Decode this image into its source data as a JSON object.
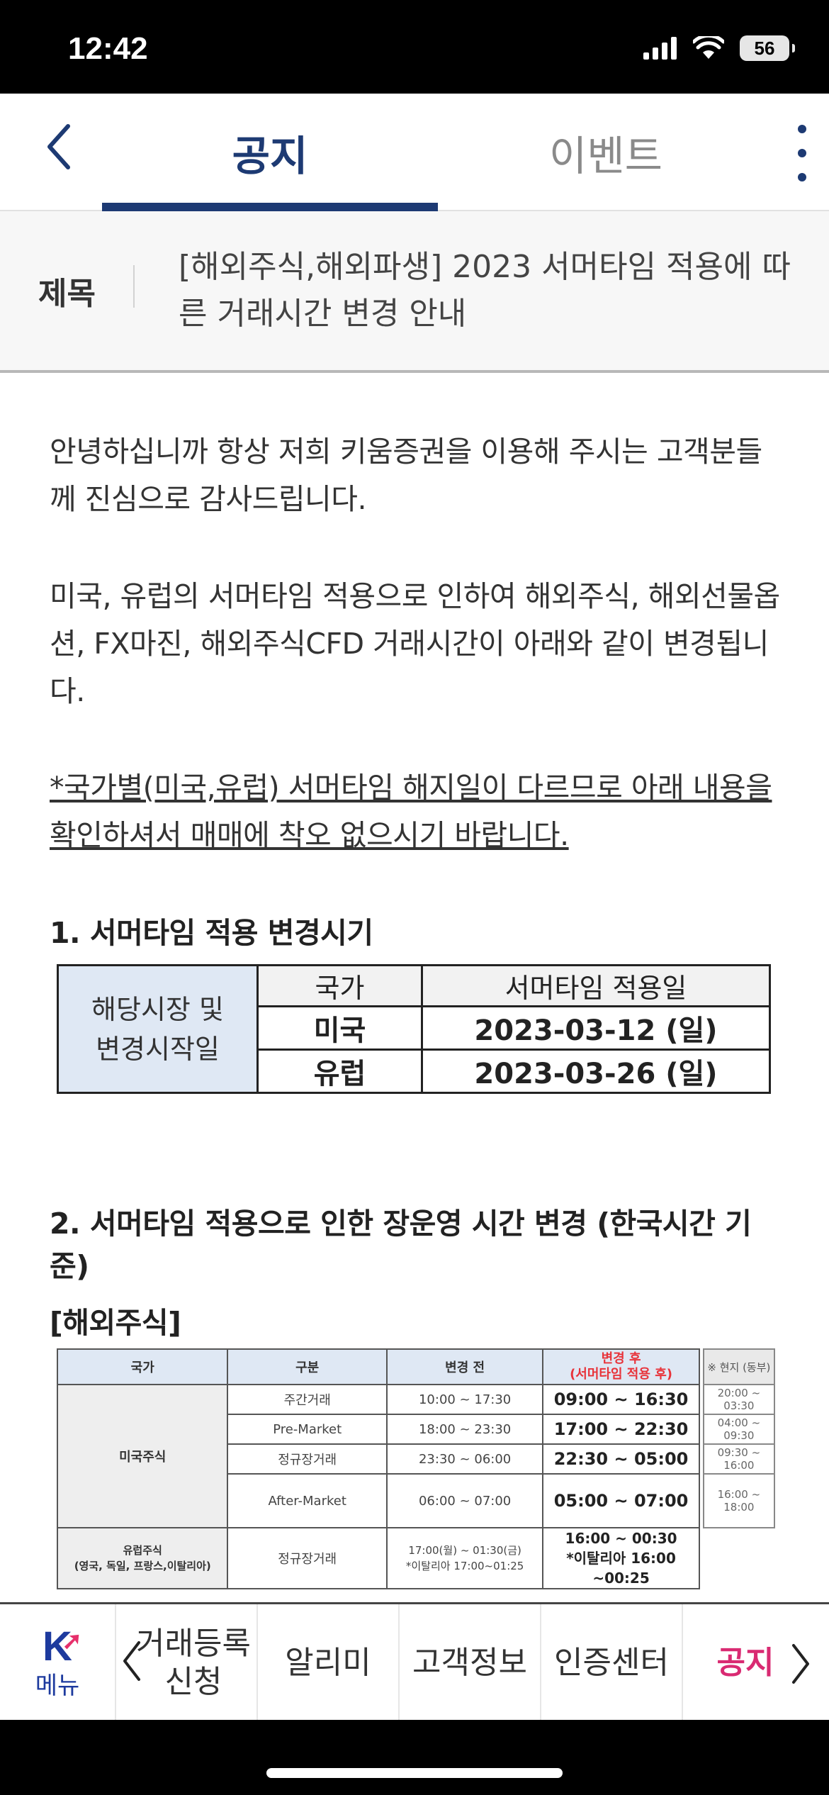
{
  "status": {
    "time": "12:42",
    "battery": "56"
  },
  "header": {
    "tabs": [
      {
        "label": "공지",
        "active": true
      },
      {
        "label": "이벤트",
        "active": false
      }
    ]
  },
  "notice": {
    "title_label": "제목",
    "title": "[해외주식,해외파생] 2023 서머타임 적용에 따른 거래시간 변경 안내",
    "paragraph1": "안녕하십니까 항상 저희 키움증권을 이용해 주시는 고객분들께 진심으로 감사드립니다.",
    "paragraph2": "미국, 유럽의 서머타임 적용으로 인하여 해외주식, 해외선물옵션, FX마진, 해외주식CFD 거래시간이 아래와 같이 변경됩니다.",
    "paragraph3": "*국가별(미국,유럽) 서머타임 해지일이 다르므로 아래 내용을 확인하셔서 매매에 착오 없으시기 바랍니다.",
    "section1_heading": "1. 서머타임 적용 변경시기",
    "section2_heading": "2. 서머타임 적용으로 인한 장운영 시간 변경 (한국시간 기준)",
    "section3_heading": "[해외주식]"
  },
  "summer_table": {
    "side_label": "해당시장 및\n변경시작일",
    "headers": [
      "국가",
      "서머타임 적용일"
    ],
    "rows": [
      {
        "country": "미국",
        "date": "2023-03-12 (일)"
      },
      {
        "country": "유럽",
        "date": "2023-03-26 (일)"
      }
    ]
  },
  "stock_table": {
    "headers": [
      "국가",
      "구분",
      "변경 전",
      "변경 후\n(서머타임 적용 후)"
    ],
    "local_header": "※ 현지 (동부)",
    "us_label": "미국주식",
    "us_rows": [
      {
        "type": "주간거래",
        "before": "10:00 ~ 17:30",
        "after": "09:00 ~ 16:30",
        "local": "20:00 ~ 03:30"
      },
      {
        "type": "Pre-Market",
        "before": "18:00 ~ 23:30",
        "after": "17:00 ~ 22:30",
        "local": "04:00 ~ 09:30"
      },
      {
        "type": "정규장거래",
        "before": "23:30 ~ 06:00",
        "after": "22:30 ~ 05:00",
        "local": "09:30 ~ 16:00"
      },
      {
        "type": "After-Market",
        "before": "06:00 ~ 07:00",
        "after": "05:00 ~ 07:00",
        "local": "16:00 ~ 18:00"
      }
    ],
    "eu_label_1": "유럽주식",
    "eu_label_2": "(영국, 독일, 프랑스,이탈리아)",
    "eu_row": {
      "type": "정규장거래",
      "before_1": "17:00(월) ~ 01:30(금)",
      "before_2": "*이탈리아 17:00~01:25",
      "after_1": "16:00 ~ 00:30",
      "after_2": "*이탈리아 16:00 ~00:25"
    }
  },
  "bottom_nav": {
    "menu_label": "메뉴",
    "items": [
      "거래등록\n신청",
      "알리미",
      "고객정보",
      "인증센터",
      "공지"
    ]
  },
  "colors": {
    "accent": "#1d3a73",
    "active_nav": "#d92a72",
    "table_header": "#dfe8f4",
    "after_red": "#e8333a"
  }
}
